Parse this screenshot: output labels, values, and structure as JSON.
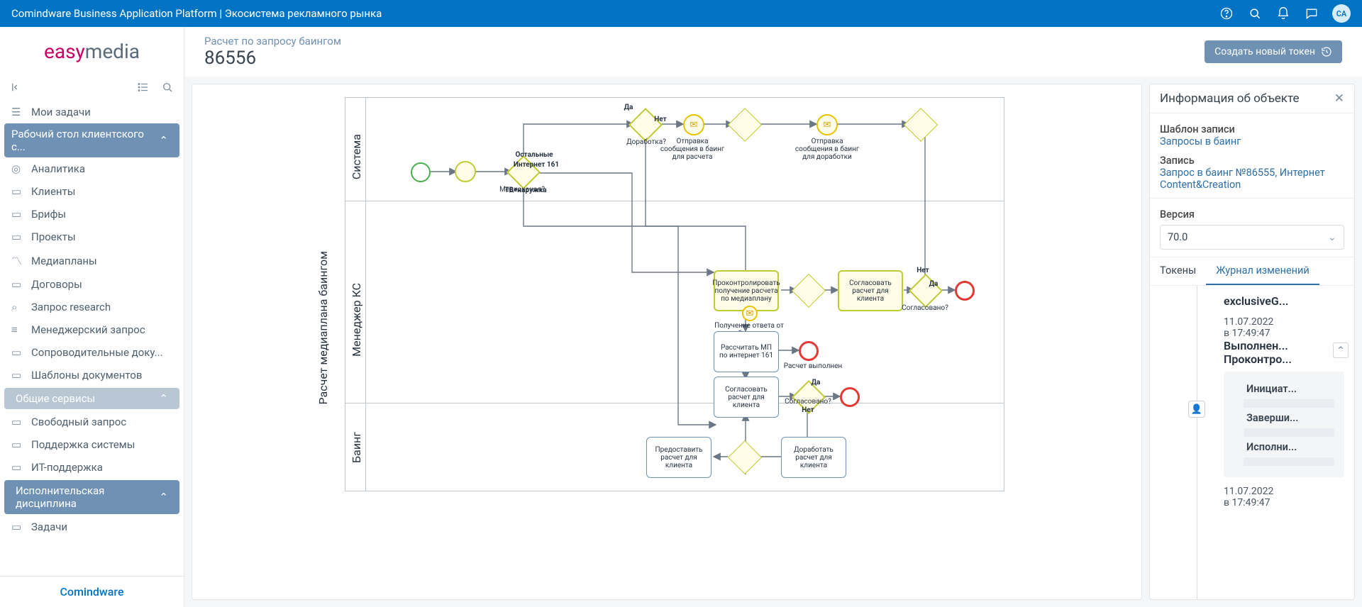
{
  "topbar": {
    "title": "Comindware Business Application Platform | Экосистема рекламного рынка",
    "avatar": "CA"
  },
  "logo": {
    "a": "easy",
    "b": "media"
  },
  "sidebar": {
    "items": [
      {
        "label": "Мои задачи"
      },
      {
        "label": "Аналитика"
      },
      {
        "label": "Клиенты"
      },
      {
        "label": "Брифы"
      },
      {
        "label": "Проекты"
      },
      {
        "label": "Медиапланы"
      },
      {
        "label": "Договоры"
      },
      {
        "label": "Запрос research"
      },
      {
        "label": "Менеджерский запрос"
      },
      {
        "label": "Сопроводительные доку..."
      },
      {
        "label": "Шаблоны документов"
      },
      {
        "label": "Свободный запрос"
      },
      {
        "label": "Поддержка системы"
      },
      {
        "label": "ИТ-поддержка"
      },
      {
        "label": "Задачи"
      }
    ],
    "sections": {
      "client": "Рабочий стол клиентского с...",
      "common": "Общие сервисы",
      "discipline": "Исполнительская дисциплина"
    }
  },
  "footer_brand": "Comindware",
  "page": {
    "breadcrumb": "Расчет по запросу баингом",
    "title": "86556",
    "create_btn": "Создать новый токен"
  },
  "right": {
    "title": "Информация об объекте",
    "tpl_label": "Шаблон записи",
    "tpl_link": "Запросы в баинг",
    "rec_label": "Запись",
    "rec_link": "Запрос в баинг №86555, Интернет Content&Creation",
    "ver_label": "Версия",
    "ver_value": "70.0",
    "tab_tokens": "Токены",
    "tab_journal": "Журнал изменений",
    "journal": {
      "top_title": "exclusiveG...",
      "e1_date": "11.07.2022",
      "e1_time": "в 17:49:47",
      "e1_l1": "Выполнен...",
      "e1_l2": "Проконтро...",
      "bullets": [
        "Инициат...",
        "Заверши...",
        "Исполни..."
      ],
      "e2_date": "11.07.2022",
      "e2_time": "в 17:49:47"
    }
  },
  "bpmn": {
    "process": "Расчет медиаплана баингом",
    "lanes": [
      "Система",
      "Менеджер КС",
      "Баинг"
    ],
    "labels": {
      "dorabotka": "Доработка?",
      "dorabotka_da": "Да",
      "dorabotka_net": "Нет",
      "send_bayiing_calc": "Отправка сообщения в баинг для расчета",
      "send_bayiing_dorab": "Отправка сообщения в баинг для доработки",
      "mediakanal": "Медиаканал?",
      "ostalnye": "Остальные",
      "inet161": "Интернет 161",
      "tvnar": "ТВ+наружка",
      "task_control": "Проконтролировать получение расчета по медиаплану",
      "task_control_sub": "Получение ответа от баинга",
      "task_agree_client1": "Согласовать расчет для клиента",
      "task_calc_161": "Рассчитать МП по интернет 161",
      "calc_done": "Расчет выполнен",
      "task_agree_client2": "Согласовать расчет для клиента",
      "soglasovano1": "Согласовано?",
      "soglasovano1_da": "Да",
      "soglasovano1_net": "Нет",
      "soglasovano2": "Согласовано?",
      "soglasovano2_da": "Да",
      "soglasovano2_net": "Нет",
      "task_provide": "Предоставить расчет для клиента",
      "task_rework": "Доработать расчет для клиента"
    }
  }
}
